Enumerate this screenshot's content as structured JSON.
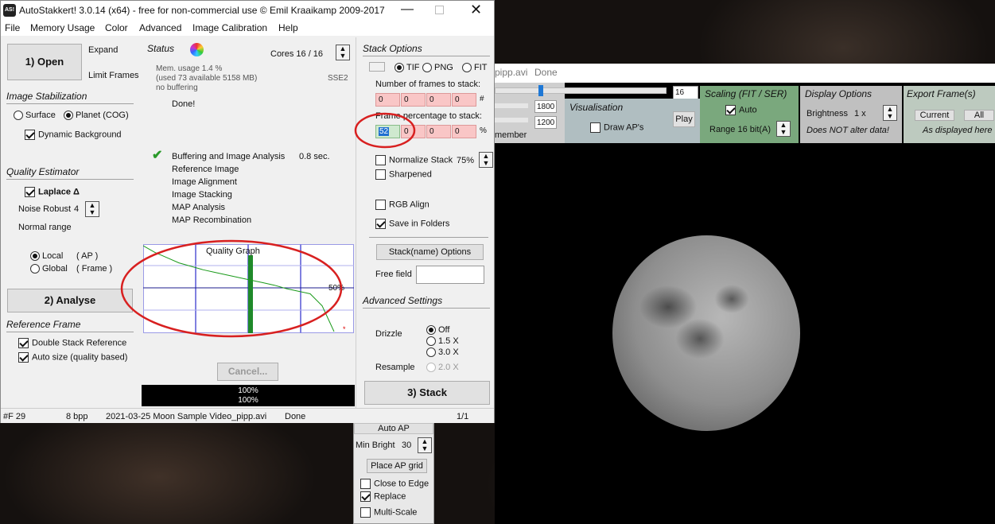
{
  "window": {
    "title": "AutoStakkert! 3.0.14 (x64) - free for non-commercial use © Emil Kraaikamp 2009-2017",
    "icon": "AS!"
  },
  "menu": [
    "File",
    "Memory Usage",
    "Color",
    "Advanced",
    "Image Calibration",
    "Help"
  ],
  "left": {
    "open": "1) Open",
    "expand": "Expand",
    "limit_frames": "Limit Frames",
    "stab_title": "Image Stabilization",
    "surface": "Surface",
    "planet": "Planet (COG)",
    "dynamic_bg": "Dynamic Background",
    "quality_title": "Quality Estimator",
    "laplace": "Laplace Δ",
    "noise_label": "Noise Robust",
    "noise_value": "4",
    "normal_range": "Normal range",
    "local": "Local",
    "local_ap": "( AP )",
    "global": "Global",
    "global_frame": "( Frame )",
    "analyse": "2) Analyse",
    "ref_title": "Reference Frame",
    "double_stack": "Double Stack Reference",
    "auto_size": "Auto size (quality based)"
  },
  "status": {
    "title": "Status",
    "cores": "Cores 16 / 16",
    "mem1": "Mem. usage 1.4 %",
    "mem2": "(used 73 available 5158 MB)",
    "mem3": "no buffering",
    "sse": "SSE2",
    "done": "Done!",
    "steps": [
      "Buffering and Image Analysis",
      "Reference Image",
      "Image Alignment",
      "Image Stacking",
      "MAP Analysis",
      "MAP Recombination"
    ],
    "buffer_time": "0.8 sec.",
    "graph_title": "Quality Graph",
    "fifty": "50%",
    "cancel": "Cancel...",
    "progress1": "100%",
    "progress2": "100%"
  },
  "stack": {
    "title": "Stack Options",
    "tif": "TIF",
    "png": "PNG",
    "fit": "FIT",
    "frames_label": "Number of frames to stack:",
    "frames": [
      "0",
      "0",
      "0",
      "0"
    ],
    "frames_unit": "#",
    "pct_label": "Frame percentage to stack:",
    "pct": [
      "52",
      "0",
      "0",
      "0"
    ],
    "pct_unit": "%",
    "normalize": "Normalize Stack",
    "normalize_val": "75%",
    "sharpened": "Sharpened",
    "rgb_align": "RGB Align",
    "save_folders": "Save in Folders",
    "name_options": "Stack(name) Options",
    "free_field": "Free field",
    "adv_title": "Advanced Settings",
    "drizzle": "Drizzle",
    "off": "Off",
    "d15": "1.5 X",
    "d30": "3.0 X",
    "resample": "Resample",
    "r20": "2.0 X",
    "stack_btn": "3) Stack"
  },
  "statusbar": {
    "frame": "#F 29",
    "bpp": "8 bpp",
    "file": "2021-03-25 Moon Sample Video_pipp.avi",
    "state": "Done",
    "page": "1/1"
  },
  "viewer": {
    "title_file": "pipp.avi",
    "title_state": "Done",
    "frame_num": "16",
    "v1800": "1800",
    "v1200": "1200",
    "member": "member",
    "vis_title": "Visualisation",
    "draw_aps": "Draw AP's",
    "play": "Play",
    "scaling_title": "Scaling (FIT / SER)",
    "auto": "Auto",
    "range": "Range 16 bit(A)",
    "display_title": "Display Options",
    "brightness": "Brightness",
    "brightness_val": "1 x",
    "not_alter": "Does NOT alter data!",
    "export_title": "Export Frame(s)",
    "current": "Current",
    "all": "All",
    "as_displayed": "As displayed here"
  },
  "ap": {
    "auto_ap": "Auto AP",
    "min_bright": "Min Bright",
    "min_bright_val": "30",
    "place_grid": "Place AP grid",
    "close_edge": "Close to Edge",
    "replace": "Replace",
    "multi_scale": "Multi-Scale"
  },
  "chart_data": {
    "type": "line",
    "title": "Quality Graph",
    "series": [
      {
        "values": [
          1.0,
          0.92,
          0.86,
          0.8,
          0.76,
          0.72,
          0.69,
          0.66,
          0.63,
          0.6,
          0.57,
          0.54,
          0.5,
          0.47,
          0.44,
          0.3,
          0.0
        ]
      }
    ],
    "annotations": [
      "50%"
    ]
  }
}
